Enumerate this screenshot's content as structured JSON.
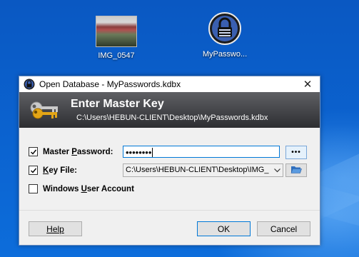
{
  "desktop": {
    "icons": [
      {
        "label": "IMG_0547"
      },
      {
        "label": "MyPasswo..."
      }
    ]
  },
  "dialog": {
    "title": "Open Database - MyPasswords.kdbx",
    "close_glyph": "✕",
    "banner": {
      "heading": "Enter Master Key",
      "path": "C:\\Users\\HEBUN-CLIENT\\Desktop\\MyPasswords.kdbx"
    },
    "master_password": {
      "label_prefix": "Master ",
      "label_underline": "P",
      "label_suffix": "assword:",
      "checked": true,
      "value": "••••••••",
      "reveal_label": "•••"
    },
    "key_file": {
      "label_underline": "K",
      "label_suffix": "ey File:",
      "checked": true,
      "value": "C:\\Users\\HEBUN-CLIENT\\Desktop\\IMG_"
    },
    "windows_account": {
      "label_prefix": "Windows ",
      "label_underline": "U",
      "label_suffix": "ser Account",
      "checked": false
    },
    "buttons": {
      "help": "Help",
      "ok": "OK",
      "cancel": "Cancel"
    }
  },
  "colors": {
    "accent": "#0078d7",
    "banner_dark": "#2d2e31",
    "desktop_blue": "#0b63d0"
  }
}
